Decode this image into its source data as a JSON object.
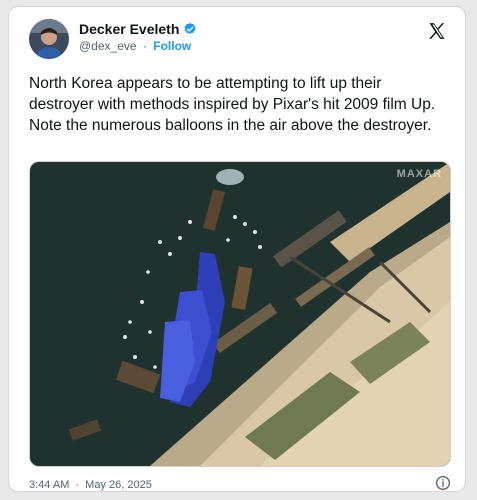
{
  "author": {
    "name": "Decker Eveleth",
    "handle": "@dex_eve",
    "follow_label": "Follow",
    "separator": "·",
    "verified_color": "#1d9bf0"
  },
  "tweet": {
    "text": "North Korea appears to be attempting to lift up their destroyer with methods inspired by Pixar's hit 2009 film Up. Note the numerous balloons in the air above the destroyer."
  },
  "media": {
    "watermark": "MAXAR",
    "description_icon": "satellite-image"
  },
  "meta": {
    "time": "3:44 AM",
    "separator": "·",
    "date": "May 26, 2025"
  },
  "icons": {
    "brand": "x-logo-icon",
    "verified": "verified-badge-icon",
    "info": "info-icon"
  }
}
